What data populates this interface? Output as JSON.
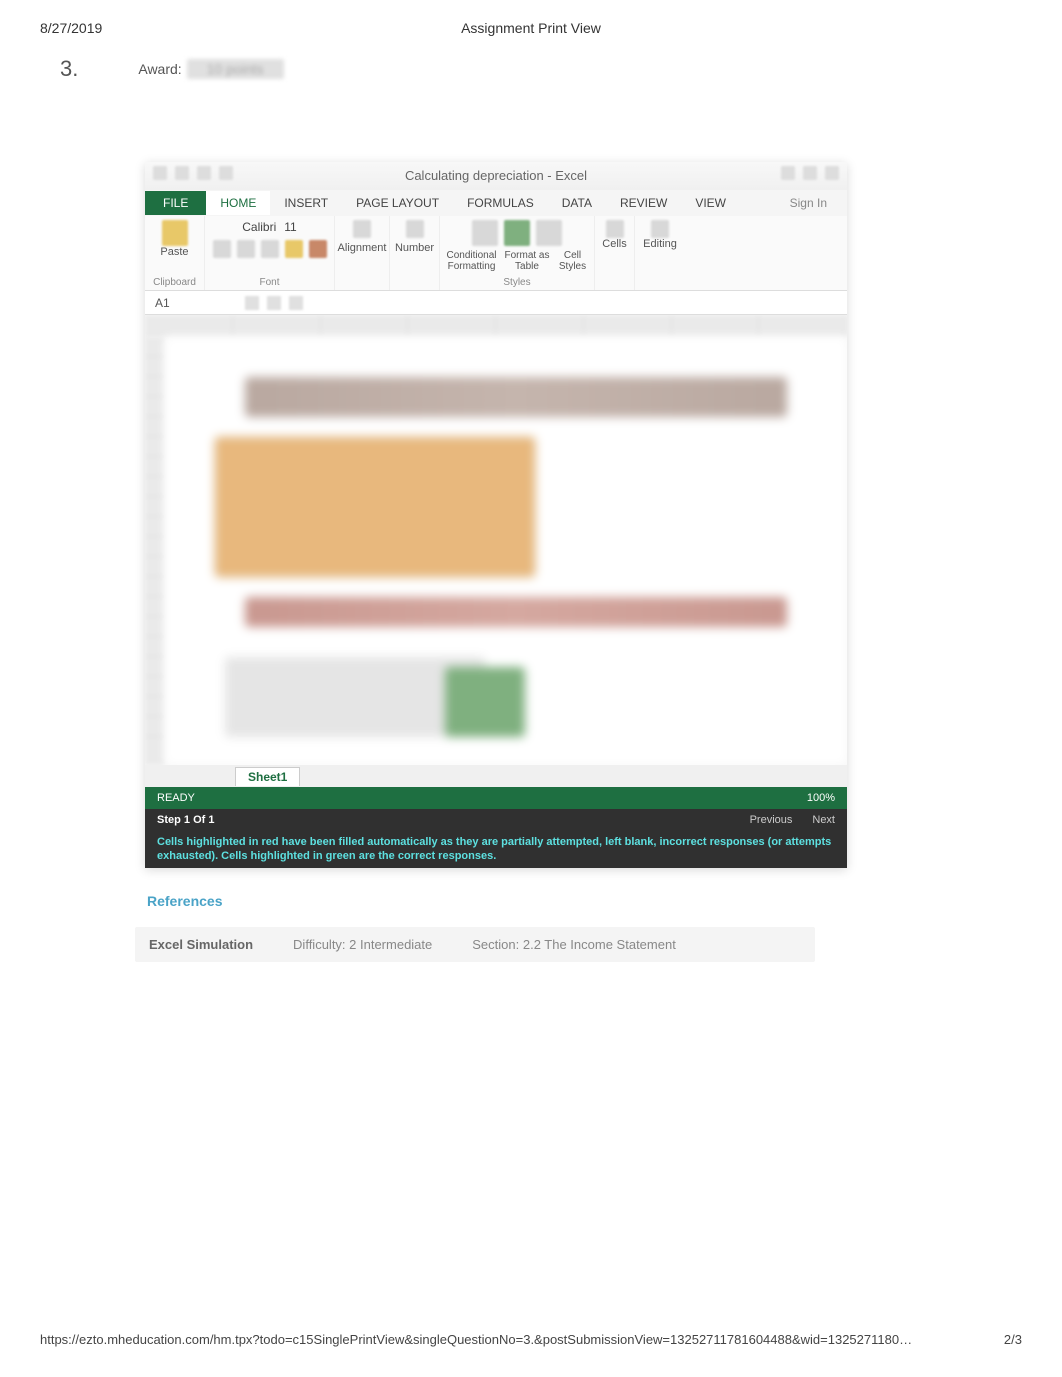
{
  "header": {
    "date": "8/27/2019",
    "title": "Assignment Print View"
  },
  "question": {
    "number": "3.",
    "award_label": "Award:",
    "award_value": "10 points"
  },
  "excel": {
    "window_title": "Calculating depreciation - Excel",
    "tabs": {
      "file": "FILE",
      "home": "HOME",
      "insert": "INSERT",
      "page_layout": "PAGE LAYOUT",
      "formulas": "FORMULAS",
      "data": "DATA",
      "review": "REVIEW",
      "view": "VIEW"
    },
    "sign_in": "Sign In",
    "ribbon": {
      "paste": "Paste",
      "clipboard": "Clipboard",
      "font_name": "Calibri",
      "font_size": "11",
      "font": "Font",
      "alignment": "Alignment",
      "number": "Number",
      "conditional_formatting": "Conditional Formatting",
      "format_as_table": "Format as Table",
      "cell_styles": "Cell Styles",
      "styles": "Styles",
      "cells": "Cells",
      "editing": "Editing"
    },
    "name_box": "A1",
    "sheet_tab": "Sheet1",
    "status": {
      "ready": "READY",
      "zoom": "100%"
    },
    "step_bar": {
      "step": "Step 1 Of 1",
      "previous": "Previous",
      "next": "Next"
    },
    "info_text": "Cells highlighted in red have been filled automatically as they are partially attempted, left blank, incorrect responses (or attempts exhausted). Cells highlighted in green are the correct responses."
  },
  "references_label": "References",
  "metadata": {
    "type": "Excel Simulation",
    "difficulty": "Difficulty: 2 Intermediate",
    "section": "Section: 2.2 The Income Statement"
  },
  "footer": {
    "url": "https://ezto.mheducation.com/hm.tpx?todo=c15SinglePrintView&singleQuestionNo=3.&postSubmissionView=13252711781604488&wid=1325271180…",
    "page": "2/3"
  }
}
